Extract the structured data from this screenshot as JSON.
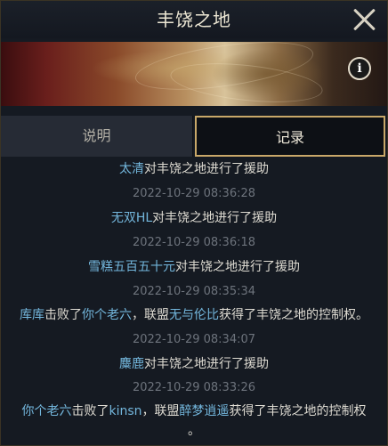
{
  "window": {
    "title": "丰饶之地",
    "close_icon": "close-icon",
    "info_icon": "info-icon"
  },
  "tabs": {
    "description": "说明",
    "records": "记录",
    "active": "records"
  },
  "records": {
    "r1": {
      "player": "太清",
      "text": "对丰饶之地进行了援助"
    },
    "t2": "2022-10-29 08:36:28",
    "r2": {
      "player": "无双HL",
      "text": "对丰饶之地进行了援助"
    },
    "t3": "2022-10-29 08:36:18",
    "r3": {
      "player": "雪糕五百五十元",
      "text": "对丰饶之地进行了援助"
    },
    "t4": "2022-10-29 08:35:34",
    "r4": {
      "player": "库库",
      "mid1": "击败了",
      "target": "你个老六",
      "mid2": "，联盟",
      "ally": "无与伦比",
      "text": "获得了丰饶之地的控制权。"
    },
    "t5": "2022-10-29 08:34:07",
    "r5": {
      "player": "麋鹿",
      "text": "对丰饶之地进行了援助"
    },
    "t6": "2022-10-29 08:33:26",
    "r6": {
      "player": "你个老六",
      "mid1": "击败了",
      "target": "kinsn",
      "mid2": "，联盟",
      "ally": "醉梦逍遥",
      "text": "获得了丰饶之地的控制权",
      "tail": "。"
    }
  }
}
